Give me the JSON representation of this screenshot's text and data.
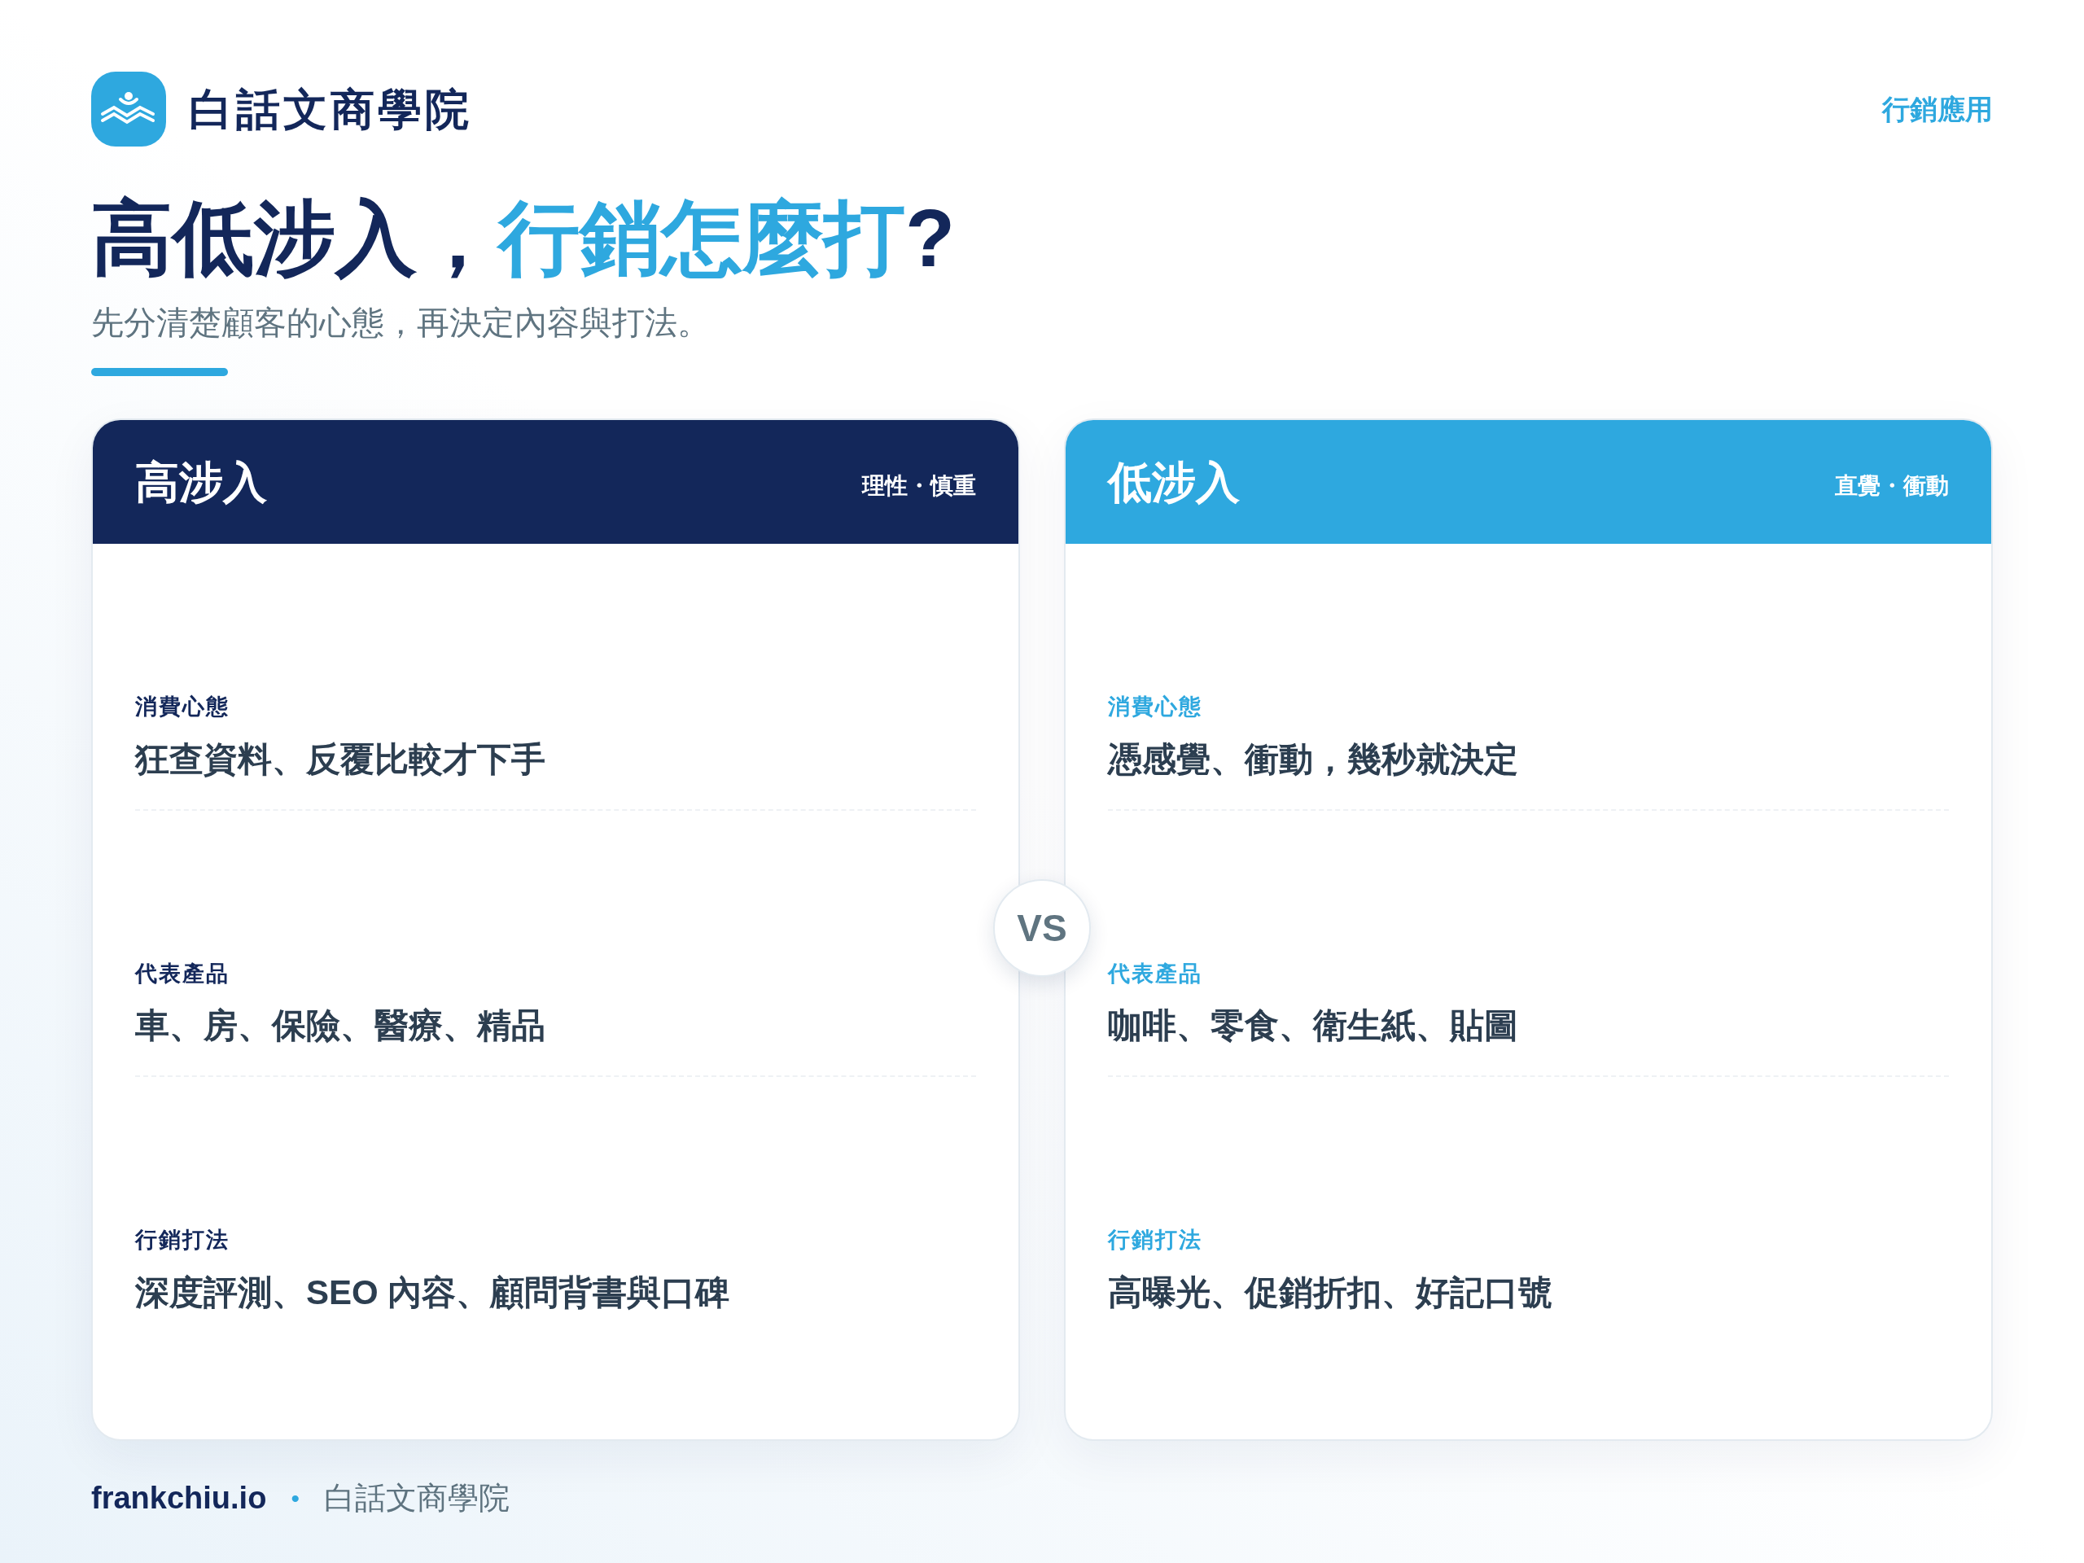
{
  "brand": {
    "name": "白話文商學院"
  },
  "category": "行銷應用",
  "title": {
    "parts": [
      {
        "text": "高低涉入，",
        "highlight": false
      },
      {
        "text": "行銷怎麼打",
        "highlight": true
      },
      {
        "text": "?",
        "highlight": false
      }
    ]
  },
  "subtitle": "先分清楚顧客的心態，再決定內容與打法。",
  "cards": [
    {
      "title": "高涉入",
      "tag": "理性・慎重",
      "color": "#13275a",
      "rows": [
        {
          "label": "消費心態",
          "value": "狂查資料、反覆比較才下手"
        },
        {
          "label": "代表產品",
          "value": "車、房、保險、醫療、精品"
        },
        {
          "label": "行銷打法",
          "value": "深度評測、SEO 內容、顧問背書與口碑"
        }
      ]
    },
    {
      "title": "低涉入",
      "tag": "直覺・衝動",
      "color": "#2ea8df",
      "rows": [
        {
          "label": "消費心態",
          "value": "憑感覺、衝動，幾秒就決定"
        },
        {
          "label": "代表產品",
          "value": "咖啡、零食、衛生紙、貼圖"
        },
        {
          "label": "行銷打法",
          "value": "高曝光、促銷折扣、好記口號"
        }
      ]
    }
  ],
  "vs_badge": "VS",
  "footer": {
    "site": "frankchiu.io",
    "separator": "•",
    "name": "白話文商學院"
  }
}
